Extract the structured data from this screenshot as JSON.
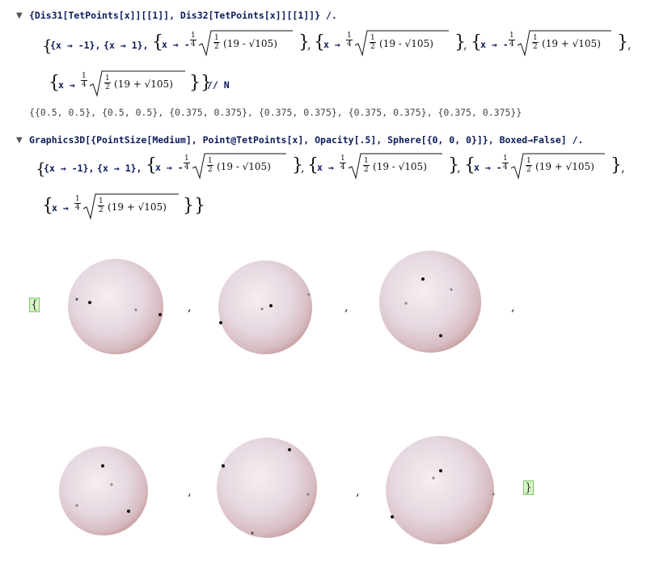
{
  "cell1": {
    "input_line": "{Dis31[TetPoints[x]][[1]], Dis32[TetPoints[x]][[1]]} /.",
    "rules": [
      {
        "var": "x",
        "arrow": "→",
        "value": "-1"
      },
      {
        "var": "x",
        "arrow": "→",
        "value": "1"
      },
      {
        "var": "x",
        "arrow": "→",
        "sign": "-",
        "coef_num": "1",
        "coef_den": "4",
        "inner_num": "1",
        "inner_den": "2",
        "inner": "19 - √105"
      },
      {
        "var": "x",
        "arrow": "→",
        "sign": "",
        "coef_num": "1",
        "coef_den": "4",
        "inner_num": "1",
        "inner_den": "2",
        "inner": "19 - √105"
      },
      {
        "var": "x",
        "arrow": "→",
        "sign": "-",
        "coef_num": "1",
        "coef_den": "4",
        "inner_num": "1",
        "inner_den": "2",
        "inner": "19 + √105"
      },
      {
        "var": "x",
        "arrow": "→",
        "sign": "",
        "coef_num": "1",
        "coef_den": "4",
        "inner_num": "1",
        "inner_den": "2",
        "inner": "19 + √105"
      }
    ],
    "postfix": "// N",
    "output": "{{0.5, 0.5}, {0.5, 0.5}, {0.375, 0.375}, {0.375, 0.375}, {0.375, 0.375}, {0.375, 0.375}}"
  },
  "cell2": {
    "input_line": "Graphics3D[{PointSize[Medium], Point@TetPoints[x], Opacity[.5], Sphere[{0, 0, 0}]}, Boxed→False] /.",
    "rules": [
      {
        "var": "x",
        "arrow": "→",
        "value": "-1"
      },
      {
        "var": "x",
        "arrow": "→",
        "value": "1"
      },
      {
        "var": "x",
        "arrow": "→",
        "sign": "-",
        "coef_num": "1",
        "coef_den": "4",
        "inner_num": "1",
        "inner_den": "2",
        "inner": "19 - √105"
      },
      {
        "var": "x",
        "arrow": "→",
        "sign": "",
        "coef_num": "1",
        "coef_den": "4",
        "inner_num": "1",
        "inner_den": "2",
        "inner": "19 - √105"
      },
      {
        "var": "x",
        "arrow": "→",
        "sign": "-",
        "coef_num": "1",
        "coef_den": "4",
        "inner_num": "1",
        "inner_den": "2",
        "inner": "19 + √105"
      },
      {
        "var": "x",
        "arrow": "→",
        "sign": "",
        "coef_num": "1",
        "coef_den": "4",
        "inner_num": "1",
        "inner_den": "2",
        "inner": "19 + √105"
      }
    ]
  },
  "output_list": {
    "open_brace": "{",
    "close_brace": "}",
    "separator": ",",
    "sphere_count": 6
  },
  "colors": {
    "input_text": "#0c1a5a",
    "output_text": "#444444",
    "bracket_green": "#d8f5c6",
    "sphere_light": "#f3e9ef",
    "sphere_dark": "#c9a6a6"
  },
  "icons": {
    "cell_toggle": "triangle-down-icon"
  }
}
